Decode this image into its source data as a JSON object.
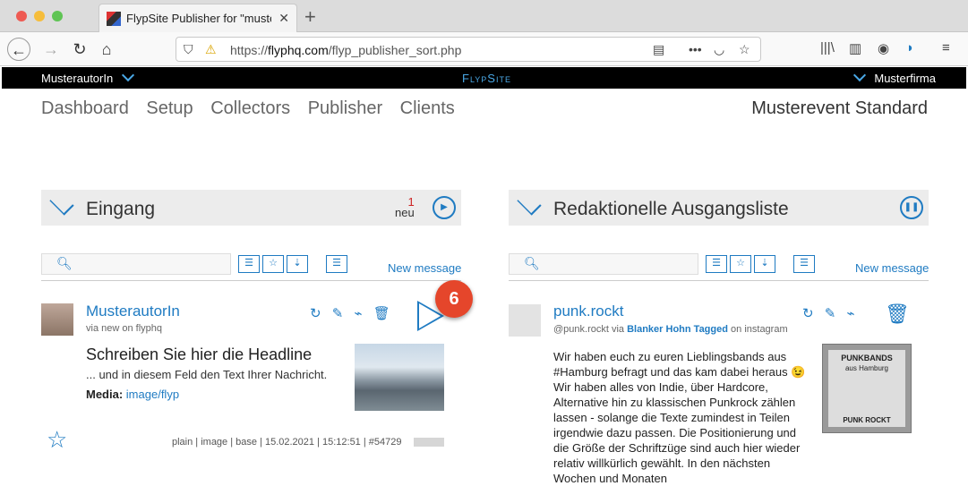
{
  "browser": {
    "tab_title": "FlypSite Publisher for \"musterfi",
    "url_prefix": "https://",
    "url_host": "flyphq.com",
    "url_path": "/flyp_publisher_sort.php"
  },
  "appbar": {
    "user": "MusterautorIn",
    "brand": "FlypSite",
    "company": "Musterfirma"
  },
  "nav": {
    "items": [
      "Dashboard",
      "Setup",
      "Collectors",
      "Publisher",
      "Clients"
    ],
    "event": "Musterevent Standard"
  },
  "left_panel": {
    "title": "Eingang",
    "counter_value": "1",
    "counter_label": "neu",
    "new_message": "New message",
    "item": {
      "author": "MusterautorIn",
      "via": "via new on flyphq",
      "headline": "Schreiben Sie hier die Headline",
      "text": "... und in diesem Feld den Text Ihrer Nachricht.",
      "media_label": "Media:",
      "media_value": "image/flyp",
      "meta": "plain | image | base | 15.02.2021 | 15:12:51 | #54729",
      "badge": "6"
    }
  },
  "right_panel": {
    "title": "Redaktionelle Ausgangsliste",
    "new_message": "New message",
    "item": {
      "author": "punk.rockt",
      "via_prefix": "@punk.rockt via",
      "via_link": "Blanker Hohn Tagged",
      "via_suffix": "on instagram",
      "text": "Wir haben euch zu euren Lieblingsbands aus #Hamburg befragt und das kam dabei heraus 😉 Wir haben alles von Indie, über Hardcore, Alternative hin zu klassischen Punkrock zählen lassen - solange die Texte zumindest in Teilen irgendwie dazu passen. Die Positionierung und die Größe der Schriftzüge sind auch hier wieder relativ willkürlich gewählt. In den nächsten Wochen und Monaten",
      "thumb_title": "PUNKBANDS",
      "thumb_sub": "aus Hamburg",
      "thumb_footer": "PUNK ROCKT"
    }
  }
}
